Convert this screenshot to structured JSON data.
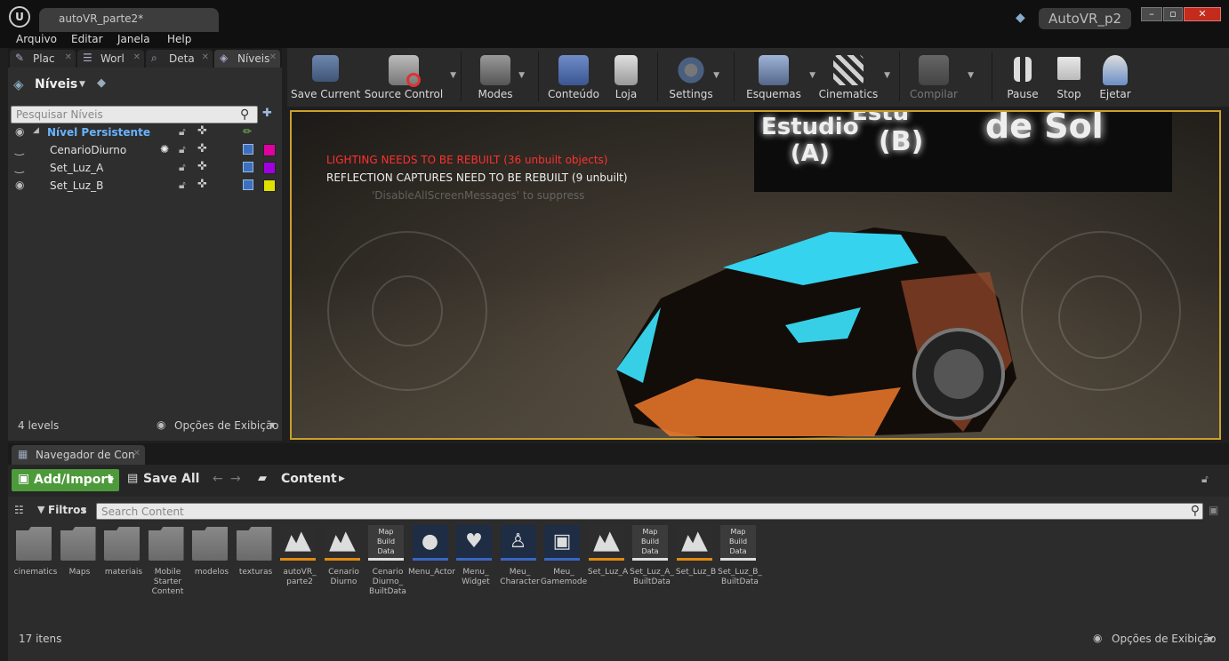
{
  "window": {
    "doc_tab": "autoVR_parte2*",
    "project": "AutoVR_p2",
    "min": "–",
    "restore": "▫",
    "close": "✕"
  },
  "menu": [
    "Arquivo",
    "Editar",
    "Janela",
    "Help"
  ],
  "left_tabs": [
    "Plac",
    "Worl",
    "Deta",
    "Níveis"
  ],
  "levels": {
    "header": "Níveis",
    "search_placeholder": "Pesquisar Níveis",
    "rows": [
      {
        "name": "Nível Persistente",
        "color": ""
      },
      {
        "name": "CenarioDiurno",
        "color": "#e000a0"
      },
      {
        "name": "Set_Luz_A",
        "color": "#a000e0"
      },
      {
        "name": "Set_Luz_B",
        "color": "#e0e000"
      }
    ],
    "count": "4 levels",
    "view_options": "Opções de Exibição"
  },
  "toolbar": {
    "items": [
      {
        "label": "Save Current",
        "icon": "save-icon"
      },
      {
        "label": "Source Control",
        "icon": "source-control-icon"
      },
      {
        "label": "Modes",
        "icon": "modes-icon"
      },
      {
        "label": "Conteúdo",
        "icon": "content-icon"
      },
      {
        "label": "Loja",
        "icon": "store-icon"
      },
      {
        "label": "Settings",
        "icon": "settings-icon"
      },
      {
        "label": "Esquemas",
        "icon": "blueprints-icon"
      },
      {
        "label": "Cinematics",
        "icon": "cinematics-icon"
      },
      {
        "label": "Compilar",
        "icon": "compile-icon"
      },
      {
        "label": "Pause",
        "icon": "pause-icon"
      },
      {
        "label": "Stop",
        "icon": "stop-icon"
      },
      {
        "label": "Ejetar",
        "icon": "eject-icon"
      }
    ]
  },
  "viewport": {
    "msg_lighting": "LIGHTING NEEDS TO BE REBUILT (36 unbuilt objects)",
    "msg_reflection": "REFLECTION CAPTURES NEED TO BE REBUILT (9 unbuilt)",
    "msg_suppress": "'DisableAllScreenMessages' to suppress",
    "sign_a": "Estudio\n(A)",
    "sign_b": "(B)",
    "sign_c": "de Sol",
    "sign_d": "Estu"
  },
  "content_browser": {
    "tab": "Navegador de Con",
    "add_import": "Add/Import",
    "save_all": "Save All",
    "path": "Content",
    "filters": "Filtros",
    "search_placeholder": "Search Content",
    "count": "17 itens",
    "view_options": "Opções de Exibição",
    "assets": [
      {
        "label": "cinematics",
        "kind": "folder"
      },
      {
        "label": "Maps",
        "kind": "folder"
      },
      {
        "label": "materiais",
        "kind": "folder"
      },
      {
        "label": "Mobile\nStarter\nContent",
        "kind": "folder"
      },
      {
        "label": "modelos",
        "kind": "folder"
      },
      {
        "label": "texturas",
        "kind": "folder"
      },
      {
        "label": "autoVR_\nparte2",
        "kind": "map"
      },
      {
        "label": "Cenario\nDiurno",
        "kind": "map"
      },
      {
        "label": "Cenario\nDiurno_\nBuiltData",
        "kind": "mapbd"
      },
      {
        "label": "Menu_Actor",
        "kind": "actor"
      },
      {
        "label": "Menu_\nWidget",
        "kind": "widget"
      },
      {
        "label": "Meu_\nCharacter",
        "kind": "character"
      },
      {
        "label": "Meu_\nGamemode",
        "kind": "gamemode"
      },
      {
        "label": "Set_Luz_A",
        "kind": "map"
      },
      {
        "label": "Set_Luz_A_\nBuiltData",
        "kind": "mapbd"
      },
      {
        "label": "Set_Luz_B",
        "kind": "map"
      },
      {
        "label": "Set_Luz_B_\nBuiltData",
        "kind": "mapbd"
      }
    ],
    "mapbd_text": "Map\nBuild\nData"
  }
}
